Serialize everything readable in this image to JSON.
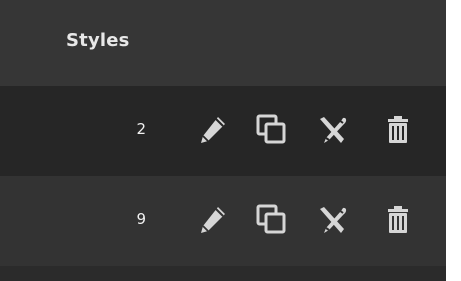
{
  "header": {
    "title": "Styles"
  },
  "rows": [
    {
      "count": "2",
      "actions": [
        "edit-icon",
        "duplicate-icon",
        "style-brush-icon",
        "trash-icon"
      ]
    },
    {
      "count": "9",
      "actions": [
        "edit-icon",
        "duplicate-icon",
        "style-brush-icon",
        "trash-icon"
      ]
    }
  ],
  "colors": {
    "header_bg": "#363636",
    "row_bg_1": "#262626",
    "row_bg_2": "#333333",
    "text": "#e8e8e8",
    "icon": "#d6d6d6"
  }
}
